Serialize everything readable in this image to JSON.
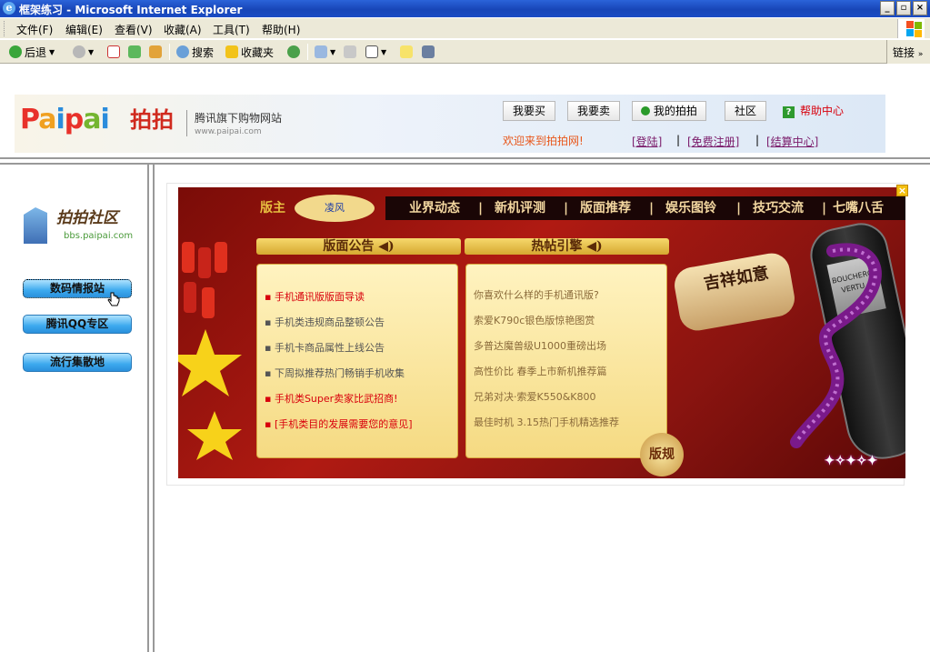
{
  "window": {
    "title": "框架练习 - Microsoft Internet Explorer",
    "icon": "ie-icon"
  },
  "menu": [
    "文件(F)",
    "编辑(E)",
    "查看(V)",
    "收藏(A)",
    "工具(T)",
    "帮助(H)"
  ],
  "toolbar": {
    "back": "后退",
    "search": "搜索",
    "favorites": "收藏夹",
    "links": "链接"
  },
  "header": {
    "logo_en": "Paipai",
    "logo_cn": "拍拍",
    "slogan": "腾讯旗下购物网站",
    "slogan_url": "www.paipai.com",
    "nav": [
      "我要买",
      "我要卖",
      "我的拍拍",
      "社区"
    ],
    "help": "帮助中心",
    "welcome": "欢迎来到拍拍网!",
    "links": [
      "[登陆]",
      "[免费注册]",
      "[结算中心]"
    ],
    "sep": "|"
  },
  "sidebar": {
    "logo_cn": "拍拍社区",
    "logo_url": "bbs.paipai.com",
    "buttons": [
      "数码情报站",
      "腾讯QQ专区",
      "流行集散地"
    ]
  },
  "banner": {
    "owner_label": "版主",
    "owner_name": "凌风",
    "nav": [
      "业界动态",
      "新机评测",
      "版面推荐",
      "娱乐图铃",
      "技巧交流",
      "七嘴八舌"
    ],
    "nav_sep": "|",
    "notice_title": "版面公告",
    "hot_title": "热帖引擎",
    "notices": [
      "手机通讯版版面导读",
      "手机类违规商品整顿公告",
      "手机卡商品属性上线公告",
      "下周拟推荐热门畅销手机收集",
      "手机类Super卖家比武招商!",
      "[手机类目的发展需要您的意见]"
    ],
    "hot": [
      "你喜欢什么样的手机通讯版?",
      "索爱K790c银色版惊艳图赏",
      "多普达魔兽级U1000重磅出场",
      "高性价比 春季上市新机推荐篇",
      "兄弟对决·索爱K550&K800",
      "最佳时机 3.15热门手机精选推荐"
    ],
    "rules": "版规",
    "cigar_text": "吉祥如意",
    "phone_brand": "BOUCHERON",
    "phone_model": "VERTU",
    "close": "×"
  },
  "colors": {
    "title_blue": "#1a4cc4",
    "chrome": "#ece9d8",
    "accent_red": "#d8000c",
    "link_purple": "#7a1a6a",
    "banner_red": "#b01a12"
  }
}
